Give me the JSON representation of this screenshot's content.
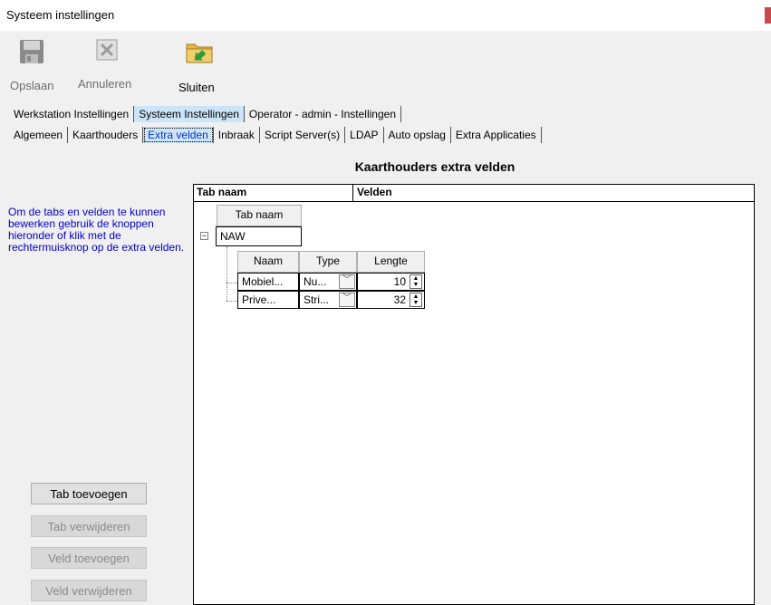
{
  "window": {
    "title": "Systeem instellingen",
    "accent_color": "#c64b4b"
  },
  "toolbar": {
    "save_label": "Opslaan",
    "cancel_label": "Annuleren",
    "close_label": "Sluiten"
  },
  "tabs_main": [
    {
      "label": "Werkstation Instellingen"
    },
    {
      "label": "Systeem Instellingen"
    },
    {
      "label": "Operator - admin - Instellingen"
    }
  ],
  "tabs_sub": [
    {
      "label": "Algemeen"
    },
    {
      "label": "Kaarthouders"
    },
    {
      "label": "Extra velden"
    },
    {
      "label": "Inbraak"
    },
    {
      "label": "Script Server(s)"
    },
    {
      "label": "LDAP"
    },
    {
      "label": "Auto opslag"
    },
    {
      "label": "Extra Applicaties"
    }
  ],
  "info_text": "Om de tabs en velden te kunnen bewerken gebruik de knoppen hieronder of klik met de rechtermuisknop op de extra velden.",
  "buttons": {
    "add_tab": "Tab toevoegen",
    "remove_tab": "Tab verwijderen",
    "add_field": "Veld toevoegen",
    "remove_field": "Veld verwijderen"
  },
  "panel": {
    "title": "Kaarthouders extra velden",
    "col_tab": "Tab naam",
    "col_fields": "Velden",
    "inner_header": "Tab naam",
    "tab_row": "NAW",
    "field_headers": {
      "name": "Naam",
      "type": "Type",
      "length": "Lengte"
    },
    "fields": [
      {
        "name": "Mobiel...",
        "type": "Nu...",
        "length": "10"
      },
      {
        "name": "Prive...",
        "type": "Stri...",
        "length": "32"
      }
    ]
  }
}
